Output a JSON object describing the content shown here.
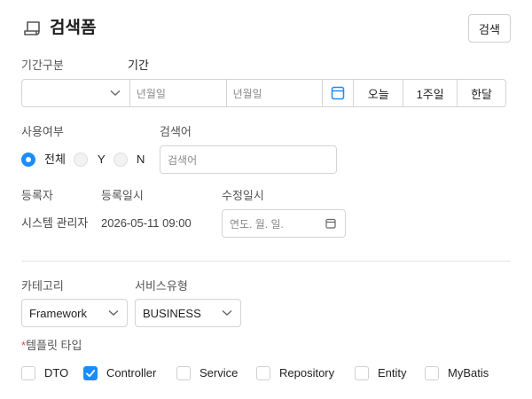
{
  "header": {
    "title": "검색폼",
    "icon": "scroll-icon",
    "search_button": "검색"
  },
  "period": {
    "type_label": "기간구분",
    "period_label": "기간",
    "type_value": "",
    "start_placeholder": "년월일",
    "end_placeholder": "년월일",
    "ranges": [
      "오늘",
      "1주일",
      "한달"
    ]
  },
  "usage": {
    "label": "사용여부",
    "options": [
      {
        "label": "전체",
        "selected": true
      },
      {
        "label": "Y",
        "selected": false
      },
      {
        "label": "N",
        "selected": false
      }
    ]
  },
  "keyword": {
    "label": "검색어",
    "placeholder": "검색어"
  },
  "meta": {
    "registrant_label": "등록자",
    "registrant_value": "시스템 관리자",
    "registered_at_label": "등록일시",
    "registered_at_value": "2026-05-11 09:00",
    "modified_at_label": "수정일시",
    "modified_at_placeholder": "연도. 월. 일."
  },
  "category": {
    "label": "카테고리",
    "value": "Framework"
  },
  "service_type": {
    "label": "서비스유형",
    "value": "BUSINESS"
  },
  "template_type": {
    "required_mark": "*",
    "label": "템플릿 타입",
    "options": [
      {
        "label": "DTO",
        "checked": false
      },
      {
        "label": "Controller",
        "checked": true
      },
      {
        "label": "Service",
        "checked": false
      },
      {
        "label": "Repository",
        "checked": false
      },
      {
        "label": "Entity",
        "checked": false
      },
      {
        "label": "MyBatis",
        "checked": false
      }
    ]
  },
  "colors": {
    "accent": "#1a8cff",
    "required": "#e5484d",
    "border": "#d4d4d4"
  }
}
